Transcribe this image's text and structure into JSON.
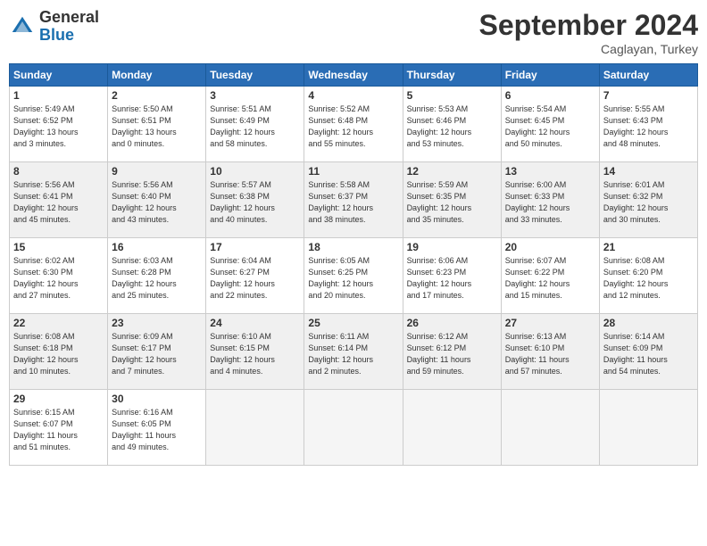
{
  "header": {
    "logo_general": "General",
    "logo_blue": "Blue",
    "month_year": "September 2024",
    "location": "Caglayan, Turkey"
  },
  "weekdays": [
    "Sunday",
    "Monday",
    "Tuesday",
    "Wednesday",
    "Thursday",
    "Friday",
    "Saturday"
  ],
  "weeks": [
    [
      {
        "day": "1",
        "info": "Sunrise: 5:49 AM\nSunset: 6:52 PM\nDaylight: 13 hours\nand 3 minutes."
      },
      {
        "day": "2",
        "info": "Sunrise: 5:50 AM\nSunset: 6:51 PM\nDaylight: 13 hours\nand 0 minutes."
      },
      {
        "day": "3",
        "info": "Sunrise: 5:51 AM\nSunset: 6:49 PM\nDaylight: 12 hours\nand 58 minutes."
      },
      {
        "day": "4",
        "info": "Sunrise: 5:52 AM\nSunset: 6:48 PM\nDaylight: 12 hours\nand 55 minutes."
      },
      {
        "day": "5",
        "info": "Sunrise: 5:53 AM\nSunset: 6:46 PM\nDaylight: 12 hours\nand 53 minutes."
      },
      {
        "day": "6",
        "info": "Sunrise: 5:54 AM\nSunset: 6:45 PM\nDaylight: 12 hours\nand 50 minutes."
      },
      {
        "day": "7",
        "info": "Sunrise: 5:55 AM\nSunset: 6:43 PM\nDaylight: 12 hours\nand 48 minutes."
      }
    ],
    [
      {
        "day": "8",
        "info": "Sunrise: 5:56 AM\nSunset: 6:41 PM\nDaylight: 12 hours\nand 45 minutes."
      },
      {
        "day": "9",
        "info": "Sunrise: 5:56 AM\nSunset: 6:40 PM\nDaylight: 12 hours\nand 43 minutes."
      },
      {
        "day": "10",
        "info": "Sunrise: 5:57 AM\nSunset: 6:38 PM\nDaylight: 12 hours\nand 40 minutes."
      },
      {
        "day": "11",
        "info": "Sunrise: 5:58 AM\nSunset: 6:37 PM\nDaylight: 12 hours\nand 38 minutes."
      },
      {
        "day": "12",
        "info": "Sunrise: 5:59 AM\nSunset: 6:35 PM\nDaylight: 12 hours\nand 35 minutes."
      },
      {
        "day": "13",
        "info": "Sunrise: 6:00 AM\nSunset: 6:33 PM\nDaylight: 12 hours\nand 33 minutes."
      },
      {
        "day": "14",
        "info": "Sunrise: 6:01 AM\nSunset: 6:32 PM\nDaylight: 12 hours\nand 30 minutes."
      }
    ],
    [
      {
        "day": "15",
        "info": "Sunrise: 6:02 AM\nSunset: 6:30 PM\nDaylight: 12 hours\nand 27 minutes."
      },
      {
        "day": "16",
        "info": "Sunrise: 6:03 AM\nSunset: 6:28 PM\nDaylight: 12 hours\nand 25 minutes."
      },
      {
        "day": "17",
        "info": "Sunrise: 6:04 AM\nSunset: 6:27 PM\nDaylight: 12 hours\nand 22 minutes."
      },
      {
        "day": "18",
        "info": "Sunrise: 6:05 AM\nSunset: 6:25 PM\nDaylight: 12 hours\nand 20 minutes."
      },
      {
        "day": "19",
        "info": "Sunrise: 6:06 AM\nSunset: 6:23 PM\nDaylight: 12 hours\nand 17 minutes."
      },
      {
        "day": "20",
        "info": "Sunrise: 6:07 AM\nSunset: 6:22 PM\nDaylight: 12 hours\nand 15 minutes."
      },
      {
        "day": "21",
        "info": "Sunrise: 6:08 AM\nSunset: 6:20 PM\nDaylight: 12 hours\nand 12 minutes."
      }
    ],
    [
      {
        "day": "22",
        "info": "Sunrise: 6:08 AM\nSunset: 6:18 PM\nDaylight: 12 hours\nand 10 minutes."
      },
      {
        "day": "23",
        "info": "Sunrise: 6:09 AM\nSunset: 6:17 PM\nDaylight: 12 hours\nand 7 minutes."
      },
      {
        "day": "24",
        "info": "Sunrise: 6:10 AM\nSunset: 6:15 PM\nDaylight: 12 hours\nand 4 minutes."
      },
      {
        "day": "25",
        "info": "Sunrise: 6:11 AM\nSunset: 6:14 PM\nDaylight: 12 hours\nand 2 minutes."
      },
      {
        "day": "26",
        "info": "Sunrise: 6:12 AM\nSunset: 6:12 PM\nDaylight: 11 hours\nand 59 minutes."
      },
      {
        "day": "27",
        "info": "Sunrise: 6:13 AM\nSunset: 6:10 PM\nDaylight: 11 hours\nand 57 minutes."
      },
      {
        "day": "28",
        "info": "Sunrise: 6:14 AM\nSunset: 6:09 PM\nDaylight: 11 hours\nand 54 minutes."
      }
    ],
    [
      {
        "day": "29",
        "info": "Sunrise: 6:15 AM\nSunset: 6:07 PM\nDaylight: 11 hours\nand 51 minutes."
      },
      {
        "day": "30",
        "info": "Sunrise: 6:16 AM\nSunset: 6:05 PM\nDaylight: 11 hours\nand 49 minutes."
      },
      {
        "day": "",
        "info": ""
      },
      {
        "day": "",
        "info": ""
      },
      {
        "day": "",
        "info": ""
      },
      {
        "day": "",
        "info": ""
      },
      {
        "day": "",
        "info": ""
      }
    ]
  ]
}
